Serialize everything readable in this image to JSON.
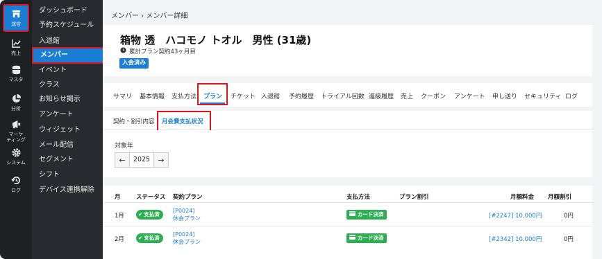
{
  "rail": [
    {
      "label": "運営",
      "icon": "store-icon",
      "active": true
    },
    {
      "label": "売上",
      "icon": "chart-icon"
    },
    {
      "label": "マスタ",
      "icon": "database-icon"
    },
    {
      "label": "分析",
      "icon": "pie-icon"
    },
    {
      "label": "マーケ\nティング",
      "icon": "megaphone-icon"
    },
    {
      "label": "システム",
      "icon": "gear-icon"
    },
    {
      "label": "ログ",
      "icon": "history-icon"
    }
  ],
  "submenu": [
    "ダッシュボード",
    "予約スケジュール",
    "入退館",
    "メンバー",
    "イベント",
    "クラス",
    "お知らせ掲示",
    "アンケート",
    "ウィジェット",
    "メール配信",
    "セグメント",
    "シフト",
    "デバイス連携解除"
  ],
  "breadcrumb": "メンバー › メンバー詳細",
  "member": {
    "title": "箱物 透　ハコモノ トオル　男性 (31歳)",
    "contract": "累計プラン契約43ヶ月目",
    "status_badge": "入会済み"
  },
  "tabs": [
    "サマリ",
    "基本情報",
    "支払方法",
    "プラン",
    "チケット",
    "入退館",
    "予約履歴",
    "トライアル回数",
    "進級履歴",
    "売上",
    "クーポン",
    "アンケート",
    "申し送り",
    "セキュリティ",
    "ログ"
  ],
  "active_tab": "プラン",
  "subtabs": [
    "契約・割引内容",
    "月会費支払状況"
  ],
  "active_subtab": "月会費支払状況",
  "year": {
    "label": "対象年",
    "value": "2025"
  },
  "table": {
    "headers": [
      "月",
      "ステータス",
      "契約プラン",
      "支払方法",
      "プラン割引",
      "月額料金",
      "月額割引"
    ],
    "rows": [
      {
        "month": "1月",
        "status": "支払済",
        "plan_code": "[P0024]",
        "plan_name": "休会プラン",
        "payment": "カード決済",
        "fee": "[#2247] 10,000円",
        "discount": "0円"
      },
      {
        "month": "2月",
        "status": "支払済",
        "plan_code": "[P0024]",
        "plan_name": "休会プラン",
        "payment": "カード決済",
        "fee": "[#2342] 10,000円",
        "discount": "0円"
      }
    ]
  },
  "colors": {
    "accent": "#1a7fd4",
    "highlight": "#e0141e",
    "success": "#2eae52",
    "rail_bg": "#1f2024"
  }
}
